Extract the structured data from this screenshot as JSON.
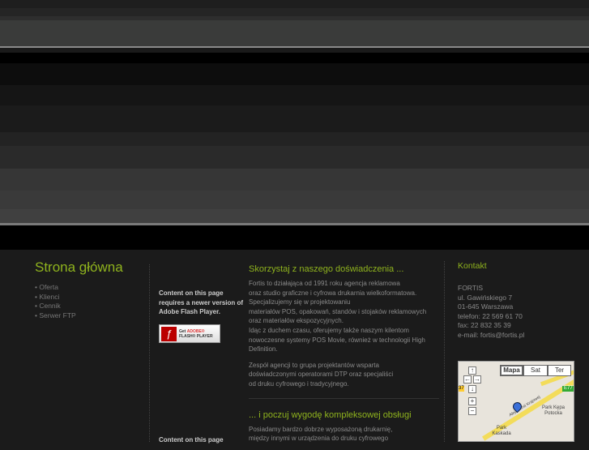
{
  "sidebar": {
    "title": "Strona główna",
    "nav": [
      "• Oferta",
      "• Klienci",
      "• Cennik",
      "• Serwer FTP"
    ]
  },
  "flash": {
    "message": "Content on this page requires a newer version of Adobe Flash Player.",
    "button_get": "Get",
    "button_adobe": "ADOBE®",
    "button_player": "FLASH® PLAYER",
    "message2": "Content on this page"
  },
  "main": {
    "heading1": "Skorzystaj z naszego doświadczenia ...",
    "para1": [
      "Fortis to działająca od 1991 roku agencja reklamowa",
      "oraz studio graficzne i cyfrowa drukarnia wielkoformatowa.",
      "Specjalizujemy się w projektowaniu",
      "materiałów POS, opakowań, standów i stojaków reklamowych",
      "oraz materiałów ekspozycyjnych.",
      "Idąc z duchem czasu, oferujemy także naszym kilentom",
      "nowoczesne systemy POS Movie, również w technologii High",
      "Definition."
    ],
    "para2": [
      "Zespół agencji to grupa projektantów wsparta",
      "doświadczonymi operatorami DTP oraz specjaliści",
      "od druku cyfrowego i tradycyjnego."
    ],
    "heading2": "... i poczuj wygodę kompleksowej obsługi",
    "para3": [
      "Posiadamy bardzo dobrze wyposażoną drukarnię,",
      "między innymi w urządzenia do druku cyfrowego"
    ]
  },
  "contact": {
    "title": "Kontakt",
    "lines": [
      "FORTIS",
      "ul. Gawińskiego 7",
      "01-645 Warszawa",
      "telefon: 22 569 61 70",
      "fax: 22 832 35 39",
      "e-mail: fortis@fortis.pl"
    ]
  },
  "map": {
    "tabs": [
      "Mapa",
      "Sat",
      "Ter"
    ],
    "labels": {
      "park1": "Park Kępa Potocka",
      "park2": "Park Kaskada",
      "road": "Aleja Armii Krajowej",
      "e77": "E77",
      "r37": "37"
    }
  }
}
